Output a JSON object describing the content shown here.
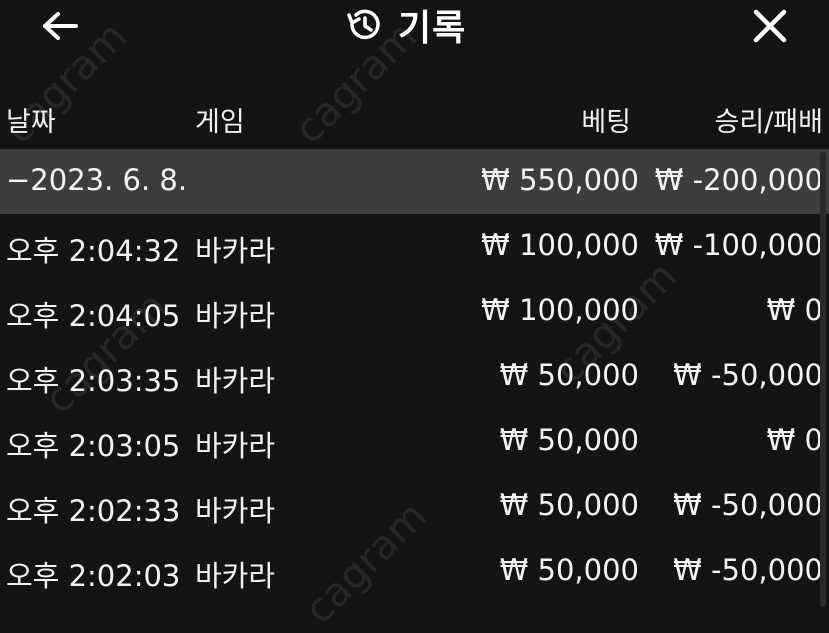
{
  "header": {
    "title": "기록",
    "back_icon": "arrow-left-icon",
    "history_icon": "history-icon",
    "close_icon": "close-icon"
  },
  "columns": {
    "date": "날짜",
    "game": "게임",
    "bet": "베팅",
    "result": "승리/패배"
  },
  "date_group": {
    "date": "−2023. 6. 8.",
    "bet": "₩ 550,000",
    "result": "₩ -200,000"
  },
  "records": [
    {
      "time": "오후 2:04:32",
      "game": "바카라",
      "bet": "₩ 100,000",
      "result": "₩ -100,000"
    },
    {
      "time": "오후 2:04:05",
      "game": "바카라",
      "bet": "₩ 100,000",
      "result": "₩ 0"
    },
    {
      "time": "오후 2:03:35",
      "game": "바카라",
      "bet": "₩ 50,000",
      "result": "₩ -50,000"
    },
    {
      "time": "오후 2:03:05",
      "game": "바카라",
      "bet": "₩ 50,000",
      "result": "₩ 0"
    },
    {
      "time": "오후 2:02:33",
      "game": "바카라",
      "bet": "₩ 50,000",
      "result": "₩ -50,000"
    },
    {
      "time": "오후 2:02:03",
      "game": "바카라",
      "bet": "₩ 50,000",
      "result": "₩ -50,000"
    }
  ],
  "colors": {
    "background": "#141414",
    "date_row": "#3d3d3d",
    "text": "#f2f2f2"
  }
}
